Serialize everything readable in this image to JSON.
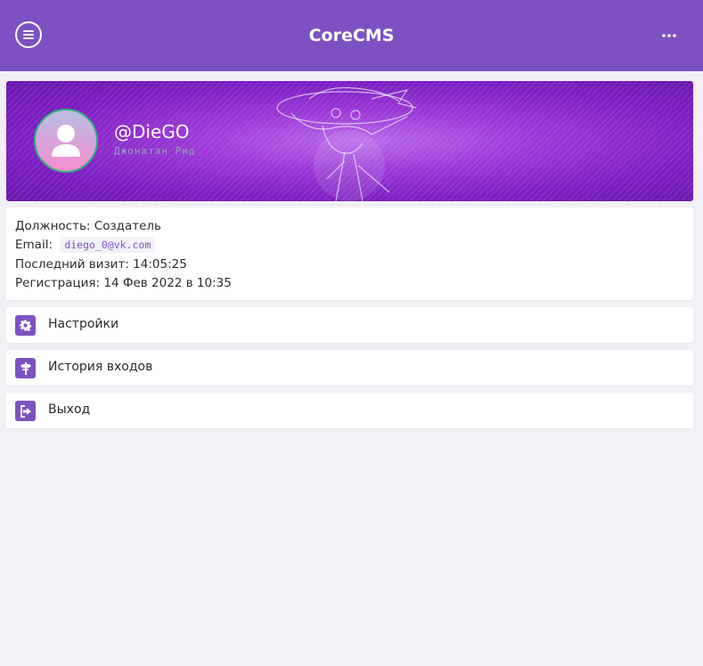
{
  "header": {
    "title": "CoreCMS",
    "menu_icon": "hamburger-icon",
    "more_icon": "more-dots-icon",
    "accent": "#7c52c2"
  },
  "profile": {
    "username": "@DieGO",
    "full_name": "Джонатан Рид",
    "avatar_icon": "user-icon"
  },
  "info": {
    "position_label": "Должность:",
    "position_value": "Создатель",
    "email_label": "Email:",
    "email_value": "diego_0@vk.com",
    "last_visit_label": "Последний визит:",
    "last_visit_value": "14:05:25",
    "registration_label": "Регистрация:",
    "registration_value": "14 Фев 2022 в 10:35"
  },
  "menu": [
    {
      "label": "Настройки",
      "icon": "gear-icon"
    },
    {
      "label": "История входов",
      "icon": "history-icon"
    },
    {
      "label": "Выход",
      "icon": "logout-icon"
    }
  ]
}
